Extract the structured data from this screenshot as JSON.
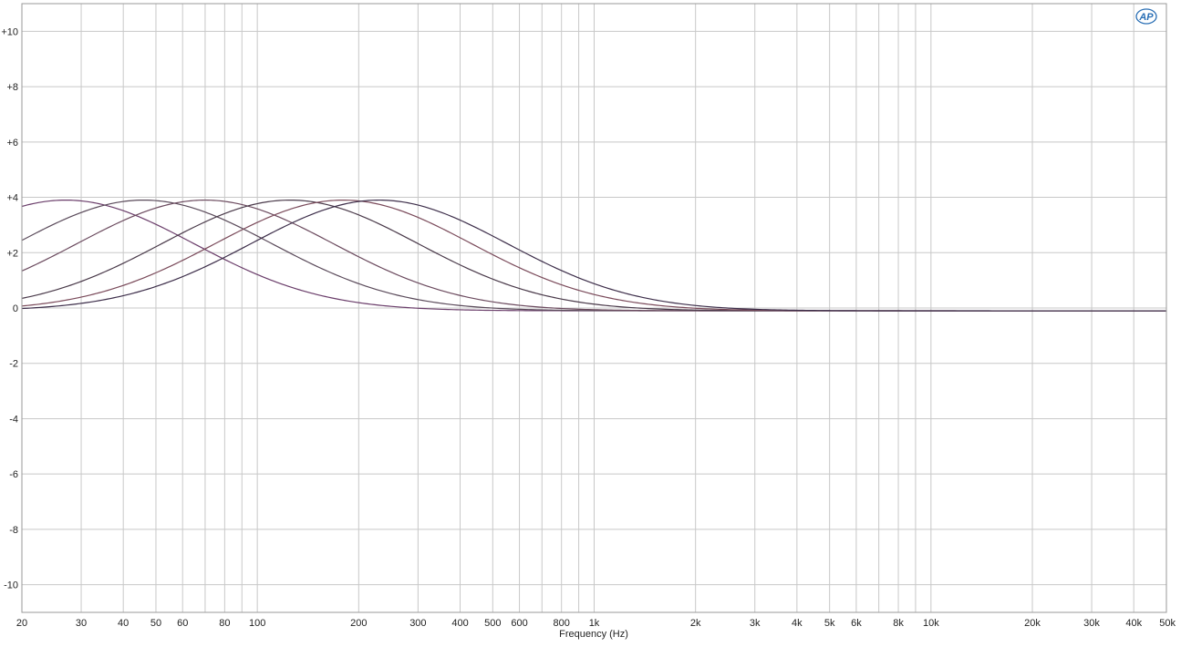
{
  "chart_data": {
    "type": "line",
    "title": "",
    "xlabel": "Frequency (Hz)",
    "ylabel": "",
    "x_scale": "log",
    "xlim": [
      20,
      50000
    ],
    "ylim": [
      -11,
      11
    ],
    "grid": true,
    "logo_text": "AP",
    "x_ticks": [
      {
        "value": 20,
        "label": "20"
      },
      {
        "value": 30,
        "label": "30"
      },
      {
        "value": 40,
        "label": "40"
      },
      {
        "value": 50,
        "label": "50"
      },
      {
        "value": 60,
        "label": "60"
      },
      {
        "value": 80,
        "label": "80"
      },
      {
        "value": 100,
        "label": "100"
      },
      {
        "value": 200,
        "label": "200"
      },
      {
        "value": 300,
        "label": "300"
      },
      {
        "value": 400,
        "label": "400"
      },
      {
        "value": 500,
        "label": "500"
      },
      {
        "value": 600,
        "label": "600"
      },
      {
        "value": 800,
        "label": "800"
      },
      {
        "value": 1000,
        "label": "1k"
      },
      {
        "value": 2000,
        "label": "2k"
      },
      {
        "value": 3000,
        "label": "3k"
      },
      {
        "value": 4000,
        "label": "4k"
      },
      {
        "value": 5000,
        "label": "5k"
      },
      {
        "value": 6000,
        "label": "6k"
      },
      {
        "value": 8000,
        "label": "8k"
      },
      {
        "value": 10000,
        "label": "10k"
      },
      {
        "value": 20000,
        "label": "20k"
      },
      {
        "value": 30000,
        "label": "30k"
      },
      {
        "value": 40000,
        "label": "40k"
      },
      {
        "value": 50000,
        "label": "50k"
      }
    ],
    "y_ticks": [
      {
        "value": 10,
        "label": "+10"
      },
      {
        "value": 8,
        "label": "+8"
      },
      {
        "value": 6,
        "label": "+6"
      },
      {
        "value": 4,
        "label": "+4"
      },
      {
        "value": 2,
        "label": "+2"
      },
      {
        "value": 0,
        "label": "0"
      },
      {
        "value": -2,
        "label": "-2"
      },
      {
        "value": -4,
        "label": "-4"
      },
      {
        "value": -6,
        "label": "-6"
      },
      {
        "value": -8,
        "label": "-8"
      },
      {
        "value": -10,
        "label": "-10"
      }
    ],
    "series": [
      {
        "color": "#6a3d6a",
        "peak_freq": 27,
        "peak_db": 3.9,
        "width_oct": 2.2,
        "x": [
          20,
          27,
          40,
          60,
          100,
          150,
          200,
          300,
          500,
          1000,
          2000,
          5000,
          10000,
          50000
        ],
        "y": [
          3.7,
          3.9,
          3.6,
          2.9,
          1.6,
          0.9,
          0.5,
          0.2,
          0.0,
          -0.1,
          -0.1,
          -0.1,
          -0.1,
          -0.1
        ]
      },
      {
        "color": "#5a4a5a",
        "peak_freq": 46,
        "peak_db": 3.9,
        "width_oct": 2.2,
        "x": [
          20,
          30,
          46,
          70,
          100,
          150,
          200,
          300,
          500,
          1000,
          2000,
          5000,
          10000,
          50000
        ],
        "y": [
          2.7,
          3.4,
          3.9,
          3.6,
          3.0,
          2.1,
          1.5,
          0.8,
          0.3,
          0.0,
          -0.1,
          -0.1,
          -0.1,
          -0.1
        ]
      },
      {
        "color": "#6b4a5e",
        "peak_freq": 70,
        "peak_db": 3.9,
        "width_oct": 2.2,
        "x": [
          20,
          30,
          50,
          70,
          100,
          150,
          200,
          300,
          500,
          1000,
          2000,
          5000,
          10000,
          50000
        ],
        "y": [
          1.8,
          2.7,
          3.6,
          3.9,
          3.6,
          2.9,
          2.2,
          1.3,
          0.6,
          0.1,
          -0.1,
          -0.1,
          -0.1,
          -0.1
        ]
      },
      {
        "color": "#4a3a4a",
        "peak_freq": 125,
        "peak_db": 3.9,
        "width_oct": 2.2,
        "x": [
          20,
          40,
          60,
          80,
          125,
          200,
          300,
          500,
          1000,
          2000,
          3000,
          5000,
          10000,
          50000
        ],
        "y": [
          0.7,
          1.8,
          2.8,
          3.4,
          3.9,
          3.4,
          2.5,
          1.3,
          0.4,
          0.1,
          0.0,
          -0.1,
          -0.1,
          -0.1
        ]
      },
      {
        "color": "#7a4a5a",
        "peak_freq": 180,
        "peak_db": 3.9,
        "width_oct": 2.2,
        "x": [
          20,
          40,
          60,
          100,
          180,
          300,
          500,
          1000,
          2000,
          3000,
          5000,
          10000,
          50000
        ],
        "y": [
          0.4,
          1.2,
          2.1,
          3.2,
          3.9,
          3.3,
          2.1,
          0.8,
          0.2,
          0.1,
          -0.1,
          -0.1,
          -0.1
        ]
      },
      {
        "color": "#3d2e4a",
        "peak_freq": 230,
        "peak_db": 3.9,
        "width_oct": 2.2,
        "x": [
          20,
          40,
          60,
          100,
          230,
          400,
          600,
          1000,
          2000,
          3000,
          5000,
          10000,
          50000
        ],
        "y": [
          0.2,
          0.7,
          1.4,
          2.6,
          3.9,
          3.3,
          2.3,
          1.3,
          0.4,
          0.1,
          -0.1,
          -0.1,
          -0.1
        ]
      }
    ]
  }
}
